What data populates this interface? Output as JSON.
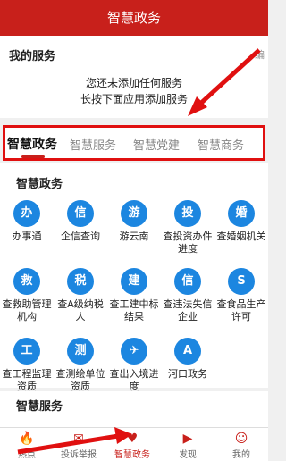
{
  "header": {
    "title": "智慧政务"
  },
  "my_service": {
    "title": "我的服务",
    "edit_label": "编",
    "hint_line1": "您还未添加任何服务",
    "hint_line2": "长按下面应用添加服务"
  },
  "tabs": [
    {
      "label": "智慧政务",
      "active": true
    },
    {
      "label": "智慧服务",
      "active": false
    },
    {
      "label": "智慧党建",
      "active": false
    },
    {
      "label": "智慧商务",
      "active": false
    }
  ],
  "section": {
    "title": "智慧政务",
    "apps": [
      {
        "label": "办事通",
        "icon": "办",
        "icon_name": "chevron-shield-icon"
      },
      {
        "label": "企信查询",
        "icon": "信",
        "icon_name": "credit-icon"
      },
      {
        "label": "游云南",
        "icon": "游",
        "icon_name": "travel-icon"
      },
      {
        "label": "查投资办件进度",
        "icon": "投",
        "icon_name": "chart-icon"
      },
      {
        "label": "查婚姻机关",
        "icon": "婚",
        "icon_name": "rings-icon"
      },
      {
        "label": "查救助管理机构",
        "icon": "救",
        "icon_name": "heart-hands-icon"
      },
      {
        "label": "查A级纳税人",
        "icon": "税",
        "icon_name": "tax-icon"
      },
      {
        "label": "查工建中标结果",
        "icon": "建",
        "icon_name": "gear-icon"
      },
      {
        "label": "查违法失信企业",
        "icon": "信",
        "icon_name": "dishonest-icon"
      },
      {
        "label": "查食品生产许可",
        "icon": "S",
        "icon_name": "food-icon"
      },
      {
        "label": "查工程监理资质",
        "icon": "工",
        "icon_name": "engineer-icon"
      },
      {
        "label": "查测绘单位资质",
        "icon": "测",
        "icon_name": "pencil-ruler-icon"
      },
      {
        "label": "查出入境进度",
        "icon": "✈",
        "icon_name": "plane-icon"
      },
      {
        "label": "河口政务",
        "icon": "A",
        "icon_name": "cloud-icon"
      }
    ]
  },
  "section2": {
    "title": "智慧服务"
  },
  "bottom_nav": [
    {
      "label": "热点",
      "icon": "🔥",
      "active": false
    },
    {
      "label": "投诉举报",
      "icon": "✉",
      "active": false
    },
    {
      "label": "智慧政务",
      "icon": "♥",
      "active": true
    },
    {
      "label": "发现",
      "icon": "▶",
      "active": false
    },
    {
      "label": "我的",
      "icon": "☺",
      "active": false
    }
  ],
  "colors": {
    "brand": "#c8201b",
    "icon_blue": "#1c86e0",
    "annotation": "#e01010"
  }
}
